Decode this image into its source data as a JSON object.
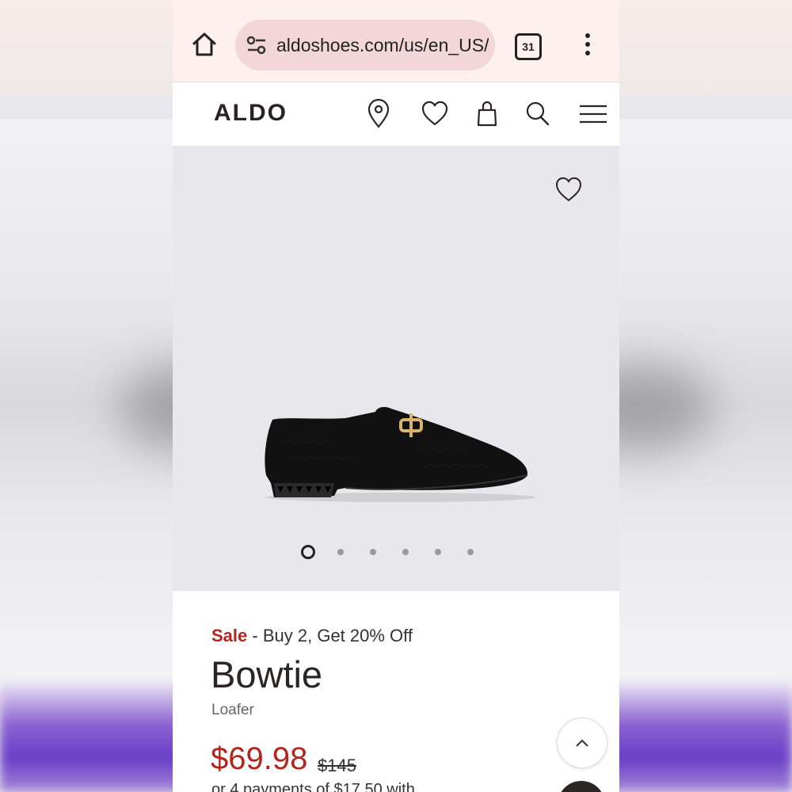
{
  "browser": {
    "url": "aldoshoes.com/us/en_US/ı",
    "tab_count": "31"
  },
  "header": {
    "logo": "ALDO"
  },
  "icons": {
    "home": "home-icon",
    "site_settings": "tune-icon",
    "tabs": "tabs-icon",
    "overflow": "more-vert-icon",
    "store_locator": "location-pin-icon",
    "wishlist": "heart-icon",
    "cart": "shopping-bag-icon",
    "search": "search-icon",
    "menu": "hamburger-menu-icon",
    "scroll_top": "chevron-up-icon"
  },
  "gallery": {
    "image_count": 6,
    "active_index": 0
  },
  "product": {
    "sale_label": "Sale",
    "promo_separator": "-",
    "promo_text": "Buy 2, Get 20% Off",
    "name": "Bowtie",
    "type": "Loafer",
    "price": "$69.98",
    "original_price": "$145",
    "installments": "or 4 payments of $17.50 with"
  },
  "colors": {
    "sale_red": "#b3261e",
    "brand_dark": "#2b2526",
    "browser_bar": "#fdf0ef",
    "url_pill": "#f2d6d8"
  }
}
